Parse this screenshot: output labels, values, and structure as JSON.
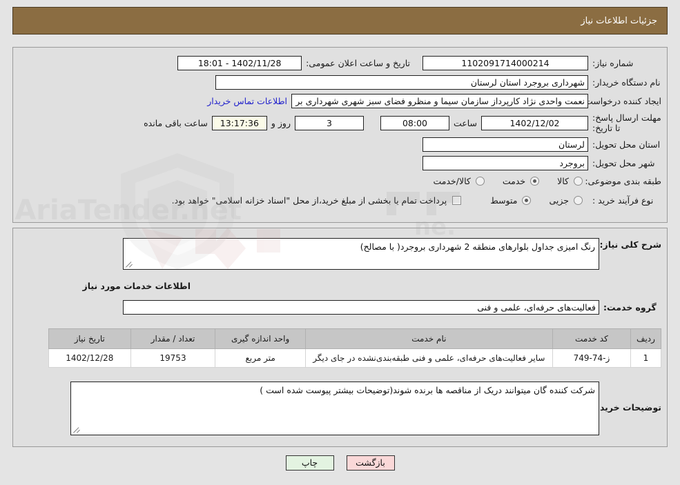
{
  "header": {
    "title": "جزئیات اطلاعات نیاز",
    "bar_color": "#8b6d42",
    "text_color": "#ffffff"
  },
  "top_form": {
    "need_number": {
      "label": "شماره نیاز:",
      "value": "1102091714000214"
    },
    "public_announcement": {
      "label": "تاریخ و ساعت اعلان عمومی:",
      "value": "1402/11/28 - 18:01"
    },
    "buyer_org": {
      "label": "نام دستگاه خریدار:",
      "value": "شهرداری بروجرد استان لرستان"
    },
    "request_creator": {
      "label": "ایجاد کننده درخواست:",
      "value": "نعمت واحدی نژاد کارپرداز سازمان سیما و منظرو فضای سبز شهری شهرداری بر",
      "contact_link": "اطلاعات تماس خریدار"
    },
    "deadline": {
      "label": "مهلت ارسال پاسخ: تا تاریخ:",
      "date": "1402/12/02",
      "time_label": "ساعت",
      "time": "08:00",
      "days": "3",
      "days_label": "روز و",
      "remaining": "13:17:36",
      "remaining_label": "ساعت باقی مانده",
      "remaining_bg": "#fbfbe8"
    },
    "delivery_province": {
      "label": "استان محل تحویل:",
      "value": "لرستان"
    },
    "delivery_city": {
      "label": "شهر محل تحویل:",
      "value": "بروجرد"
    },
    "subject_class": {
      "label": "طبقه بندی موضوعی:",
      "options": [
        {
          "text": "کالا",
          "selected": false
        },
        {
          "text": "خدمت",
          "selected": true
        },
        {
          "text": "کالا/خدمت",
          "selected": false
        }
      ]
    },
    "purchase_process": {
      "label": "نوع فرآیند خرید :",
      "options": [
        {
          "text": "جزیی",
          "selected": false
        },
        {
          "text": "متوسط",
          "selected": true
        }
      ]
    },
    "treasury_note": {
      "checked": false,
      "text": "پرداخت تمام یا بخشی از مبلغ خرید،از محل \"اسناد خزانه اسلامی\" خواهد بود."
    }
  },
  "middle": {
    "general_description": {
      "label": "شرح کلی نیاز:",
      "value": "رنگ امیزی جداول بلوارهای منطقه 2 شهرداری بروجرد( با مصالح)"
    },
    "services_heading": "اطلاعات خدمات مورد نیاز",
    "service_group": {
      "label": "گروه خدمت:",
      "value": "فعالیت‌های حرفه‌ای، علمی و فنی"
    },
    "table": {
      "columns": [
        "ردیف",
        "کد خدمت",
        "نام خدمت",
        "واحد اندازه گیری",
        "تعداد / مقدار",
        "تاریخ نیاز"
      ],
      "rows": [
        {
          "row_no": "1",
          "service_code": "ز-74-749",
          "service_name": "سایر فعالیت‌های حرفه‌ای، علمی و فنی طبقه‌بندی‌نشده در جای دیگر",
          "unit": "متر مربع",
          "quantity": "19753",
          "need_date": "1402/12/28"
        }
      ]
    },
    "buyer_notes": {
      "label": "توضیحات خریدار:",
      "value": "شرکت کننده گان میتوانند دریک از مناقصه ها برنده شوند(توضیحات بیشتر پیوست شده است )"
    }
  },
  "buttons": {
    "print": {
      "label": "چاپ",
      "bg": "#e3f3e1"
    },
    "back": {
      "label": "بازگشت",
      "bg": "#fad8d8"
    }
  }
}
